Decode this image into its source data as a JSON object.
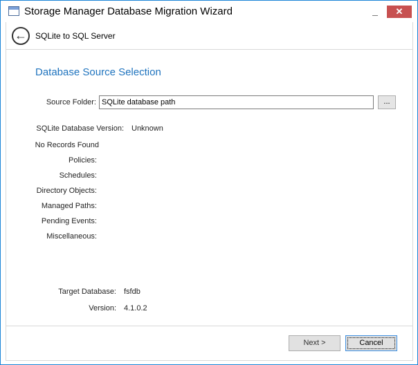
{
  "window": {
    "title": "Storage Manager Database Migration Wizard",
    "minimize": "_",
    "close": "✕"
  },
  "header": {
    "back_icon": "←",
    "breadcrumb": "SQLite to SQL Server"
  },
  "page": {
    "heading": "Database Source Selection"
  },
  "source": {
    "label": "Source Folder:",
    "value": "SQLite database path",
    "browse": "..."
  },
  "sqlite_version": {
    "label": "SQLite Database Version:",
    "value": "Unknown"
  },
  "records": {
    "status": "No Records Found",
    "items": [
      "Policies:",
      "Schedules:",
      "Directory Objects:",
      "Managed Paths:",
      "Pending Events:",
      "Miscellaneous:"
    ]
  },
  "target": {
    "db_label": "Target Database:",
    "db_value": "fsfdb",
    "version_label": "Version:",
    "version_value": "4.1.0.2"
  },
  "buttons": {
    "next": "Next >",
    "cancel": "Cancel"
  }
}
